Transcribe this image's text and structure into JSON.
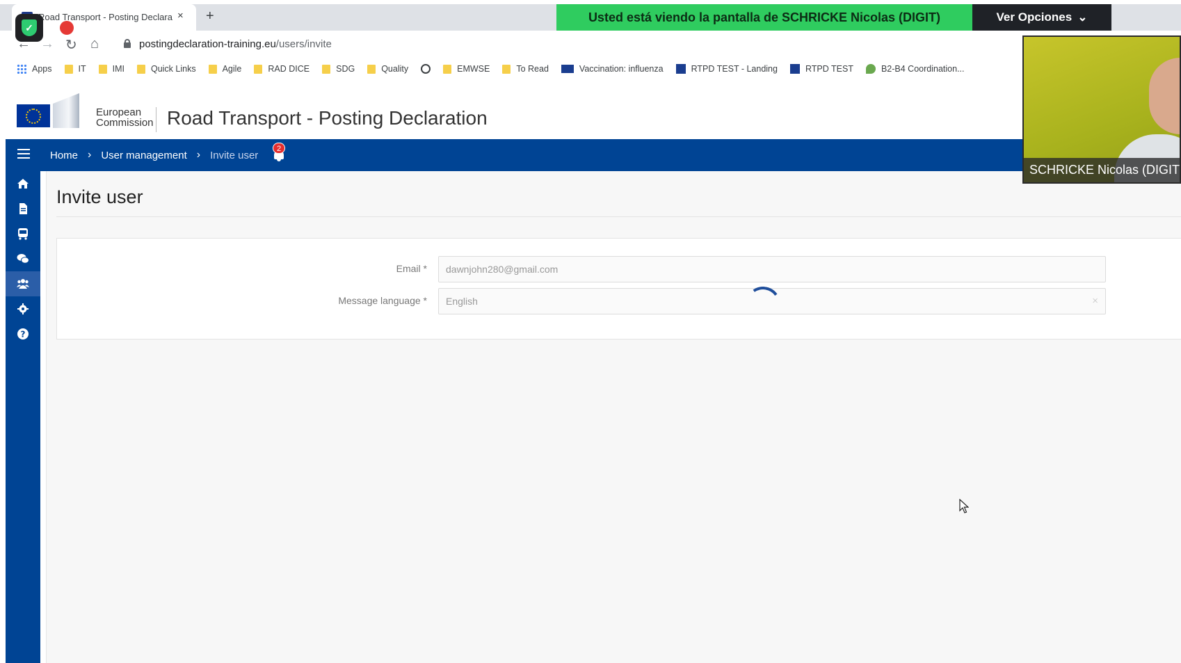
{
  "browser": {
    "tab_title": "Road Transport - Posting Declara",
    "tab_close": "×",
    "new_tab": "+",
    "url_domain": "postingdeclaration-training.eu",
    "url_path": "/users/invite",
    "bookmarks": [
      "Apps",
      "IT",
      "IMI",
      "Quick Links",
      "Agile",
      "RAD DICE",
      "SDG",
      "Quality",
      "",
      "EMWSE",
      "To Read",
      "Vaccination: influenza",
      "RTPD TEST - Landing",
      "RTPD TEST",
      "B2-B4 Coordination..."
    ]
  },
  "screen_share": {
    "banner": "Usted está viendo la pantalla de SCHRICKE Nicolas (DIGIT)",
    "options_label": "Ver Opciones",
    "options_chevron": "⌄",
    "presenter_name": "SCHRICKE Nicolas (DIGIT)"
  },
  "header": {
    "org_line1": "European",
    "org_line2": "Commission",
    "app_title": "Road Transport - Posting Declaration"
  },
  "navbar": {
    "crumbs": [
      "Home",
      "User management",
      "Invite user"
    ],
    "crumb_separator": "›",
    "notification_count": "2"
  },
  "sidebar": {
    "icons": [
      "home-icon",
      "document-icon",
      "bus-icon",
      "comments-icon",
      "users-icon",
      "gear-icon",
      "help-icon"
    ],
    "active_index": 4
  },
  "page": {
    "title": "Invite user",
    "form": {
      "email_label": "Email *",
      "email_value": "dawnjohn280@gmail.com",
      "language_label": "Message language *",
      "language_value": "English",
      "clear_symbol": "×"
    }
  }
}
